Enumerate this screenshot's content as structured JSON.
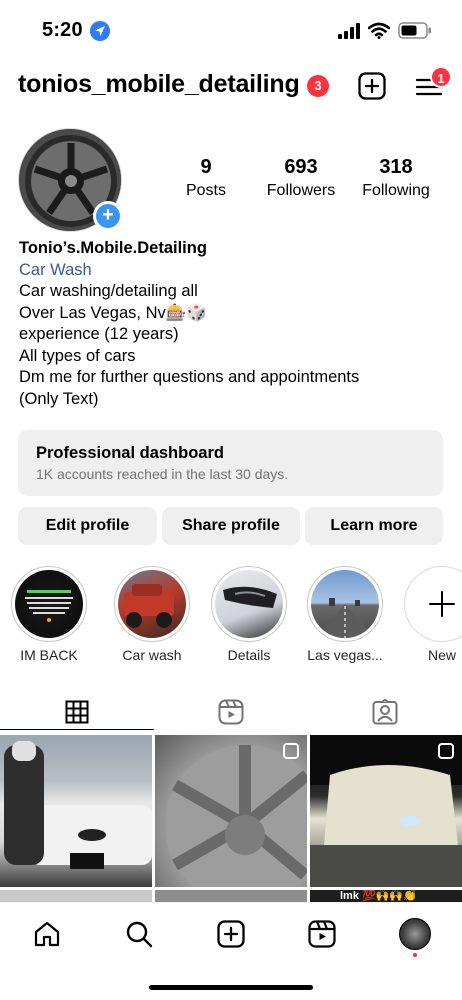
{
  "status_bar": {
    "time": "5:20",
    "icons": [
      "location-icon",
      "signal-icon",
      "wifi-icon",
      "battery-icon"
    ]
  },
  "header": {
    "username": "tonios_mobile_detailing",
    "notification_count": "3",
    "menu_badge_count": "1",
    "icons": [
      "create-icon",
      "menu-icon"
    ]
  },
  "profile": {
    "stats": {
      "posts_count": "9",
      "posts_label": "Posts",
      "followers_count": "693",
      "followers_label": "Followers",
      "following_count": "318",
      "following_label": "Following"
    },
    "avatar_add": "+"
  },
  "bio": {
    "name": "Tonio’s.Mobile.Detailing",
    "category": "Car Wash",
    "lines": [
      "Car washing/detailing all",
      "Over Las Vegas, Nv🎰🎲",
      "experience (12 years)",
      "All types of cars",
      "Dm me for further questions and appointments",
      "(Only Text)"
    ]
  },
  "dashboard": {
    "title": "Professional dashboard",
    "subtitle": "1K accounts reached in the last 30 days."
  },
  "actions": {
    "edit": "Edit profile",
    "share": "Share profile",
    "learn": "Learn more"
  },
  "highlights": [
    {
      "label": "IM BACK"
    },
    {
      "label": "Car wash"
    },
    {
      "label": "Details"
    },
    {
      "label": "Las vegas..."
    },
    {
      "label": "New"
    }
  ],
  "tabs": [
    "grid-icon",
    "reels-icon",
    "tagged-icon"
  ],
  "posts_partial_text": "lmk 💯🙌🙌👏",
  "bottom_nav": [
    "home-icon",
    "search-icon",
    "create-icon",
    "reels-icon",
    "profile-avatar"
  ],
  "colors": {
    "badge": "#ff3040",
    "accent_blue": "#3797f0",
    "category_link": "#385898",
    "button_bg": "#efefef"
  }
}
